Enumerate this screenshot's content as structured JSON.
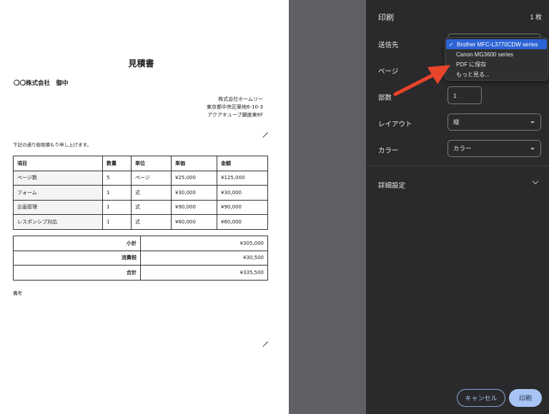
{
  "document": {
    "title": "見積書",
    "client": "〇〇株式会社　御中",
    "company_lines": [
      "株式会社ホームリー",
      "東京都中央区築地6-10-3",
      "アクアキューブ銀座東6F"
    ],
    "intro": "下記の通り御見積もり申し上げます。",
    "table_headers": [
      "項目",
      "数量",
      "単位",
      "単価",
      "金額"
    ],
    "table_rows": [
      [
        "ページ数",
        "5",
        "ページ",
        "¥25,000",
        "¥125,000"
      ],
      [
        "フォーム",
        "1",
        "式",
        "¥30,000",
        "¥30,000"
      ],
      [
        "企画管理",
        "1",
        "式",
        "¥90,000",
        "¥90,000"
      ],
      [
        "レスポンシブ対応",
        "1",
        "式",
        "¥60,000",
        "¥60,000"
      ]
    ],
    "totals": [
      {
        "label": "小計",
        "value": "¥305,000"
      },
      {
        "label": "消費税",
        "value": "¥30,500"
      },
      {
        "label": "合計",
        "value": "¥335,500"
      }
    ],
    "note_label": "備考"
  },
  "print_panel": {
    "title": "印刷",
    "sheet_count": "1 枚",
    "destination_label": "送信先",
    "pages_label": "ページ",
    "copies_label": "部数",
    "copies_value": "1",
    "layout_label": "レイアウト",
    "layout_value": "縦",
    "color_label": "カラー",
    "color_value": "カラー",
    "details_label": "詳細設定",
    "cancel_label": "キャンセル",
    "print_label": "印刷"
  },
  "destination_dropdown": {
    "options": [
      {
        "label": "Brother MFC-L3770CDW series",
        "selected": true
      },
      {
        "label": "Canon MG3600 series",
        "selected": false
      },
      {
        "label": "PDF に保存",
        "selected": false
      },
      {
        "label": "もっと見る...",
        "selected": false
      }
    ],
    "check_glyph": "✓"
  },
  "colors": {
    "panel_bg": "#2a2a2c",
    "gutter_bg": "#5f6063",
    "selected_option": "#2c63d6",
    "primary_button": "#a8c4f5",
    "annotation_arrow": "#e8442a"
  }
}
